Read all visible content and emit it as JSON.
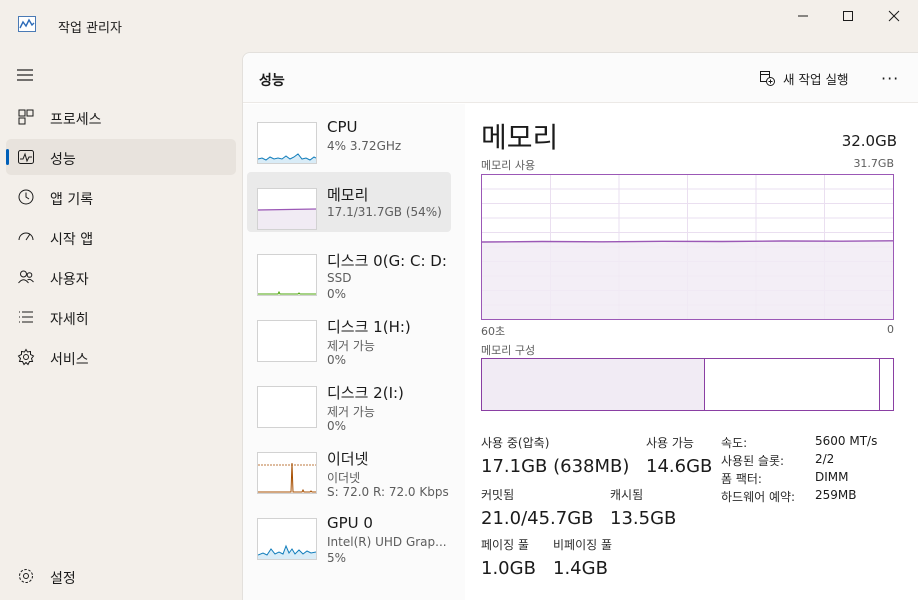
{
  "window": {
    "title": "작업 관리자",
    "controls": [
      "minimize",
      "maximize",
      "close"
    ]
  },
  "sidebar": {
    "items": [
      {
        "label": "프로세스",
        "icon": "processes-icon"
      },
      {
        "label": "성능",
        "icon": "performance-icon",
        "active": true
      },
      {
        "label": "앱 기록",
        "icon": "app-history-icon"
      },
      {
        "label": "시작 앱",
        "icon": "startup-apps-icon"
      },
      {
        "label": "사용자",
        "icon": "users-icon"
      },
      {
        "label": "자세히",
        "icon": "details-icon"
      },
      {
        "label": "서비스",
        "icon": "services-icon"
      }
    ],
    "settings_label": "설정"
  },
  "header": {
    "title": "성능",
    "run_task_label": "새 작업 실행",
    "more_label": "···"
  },
  "devices": [
    {
      "name": "CPU",
      "sub1": "4% 3.72GHz",
      "sub2": ""
    },
    {
      "name": "메모리",
      "sub1": "17.1/31.7GB (54%)",
      "sub2": "",
      "selected": true
    },
    {
      "name": "디스크 0(G: C: D:",
      "sub1": "SSD",
      "sub2": "0%"
    },
    {
      "name": "디스크 1(H:)",
      "sub1": "제거 가능",
      "sub2": "0%"
    },
    {
      "name": "디스크 2(I:)",
      "sub1": "제거 가능",
      "sub2": "0%"
    },
    {
      "name": "이더넷",
      "sub1": "이더넷",
      "sub2": "S: 72.0  R: 72.0 Kbps"
    },
    {
      "name": "GPU 0",
      "sub1": "Intel(R) UHD Grap...",
      "sub2": "5%"
    }
  ],
  "detail": {
    "title": "메모리",
    "total": "32.0GB",
    "usage_label": "메모리 사용",
    "usage_max": "31.7GB",
    "time_left": "60초",
    "time_right": "0",
    "composition_label": "메모리 구성",
    "usage_fraction": 0.54,
    "stats": {
      "in_use_label": "사용 중(압축)",
      "in_use_value": "17.1GB (638MB)",
      "available_label": "사용 가능",
      "available_value": "14.6GB",
      "committed_label": "커밋됨",
      "committed_value": "21.0/45.7GB",
      "cached_label": "캐시됨",
      "cached_value": "13.5GB",
      "paged_label": "페이징 풀",
      "paged_value": "1.0GB",
      "nonpaged_label": "비페이징 풀",
      "nonpaged_value": "1.4GB"
    },
    "specs": [
      {
        "key": "속도:",
        "value": "5600 MT/s"
      },
      {
        "key": "사용된 슬롯:",
        "value": "2/2"
      },
      {
        "key": "폼 팩터:",
        "value": "DIMM"
      },
      {
        "key": "하드웨어 예약:",
        "value": "259MB"
      }
    ]
  },
  "colors": {
    "memory": "#9b58b6",
    "cpu": "#117dbb",
    "disk": "#4da60c",
    "ethernet": "#a74f01",
    "accent": "#005fb8"
  }
}
